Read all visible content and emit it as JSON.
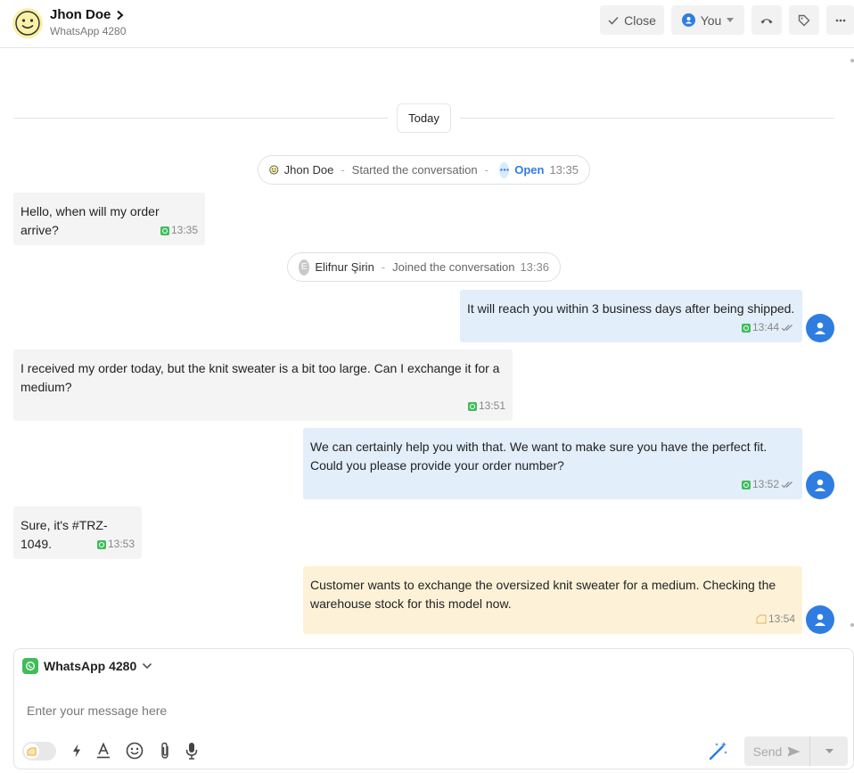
{
  "header": {
    "contact_name": "Jhon Doe",
    "channel": "WhatsApp 4280",
    "close_label": "Close",
    "assignee_label": "You"
  },
  "chat": {
    "date_divider": "Today",
    "events": [
      {
        "name": "Jhon Doe",
        "action": "Started the conversation",
        "separator": "-",
        "status": "Open",
        "time": "13:35"
      },
      {
        "avatar_letter": "E",
        "name": "Elifnur Şirin",
        "action": "Joined the conversation",
        "separator": "-",
        "time": "13:36"
      }
    ],
    "messages": [
      {
        "direction": "in",
        "text": "Hello, when will my order arrive?",
        "time": "13:35"
      },
      {
        "direction": "out",
        "text": "It will reach you within 3 business days after being shipped.",
        "time": "13:44"
      },
      {
        "direction": "in",
        "text": "I received my order today, but the knit sweater is a bit too large. Can I exchange it for a medium?",
        "time": "13:51"
      },
      {
        "direction": "out",
        "text": "We can certainly help you with that. We want to make sure you have the perfect fit. Could you please provide your order number?",
        "time": "13:52"
      },
      {
        "direction": "in",
        "text": "Sure, it's #TRZ-1049.",
        "time": "13:53"
      },
      {
        "direction": "note",
        "text": "Customer wants to exchange the oversized knit sweater for a medium. Checking the warehouse stock for this model now.",
        "time": "13:54"
      }
    ]
  },
  "composer": {
    "channel": "WhatsApp 4280",
    "placeholder": "Enter your message here",
    "send_label": "Send"
  },
  "colors": {
    "accent": "#2f7de1",
    "incoming_bg": "#f4f4f4",
    "outgoing_bg": "#e2eefa",
    "note_bg": "#fdf2d8",
    "whatsapp": "#3fbd5a"
  }
}
